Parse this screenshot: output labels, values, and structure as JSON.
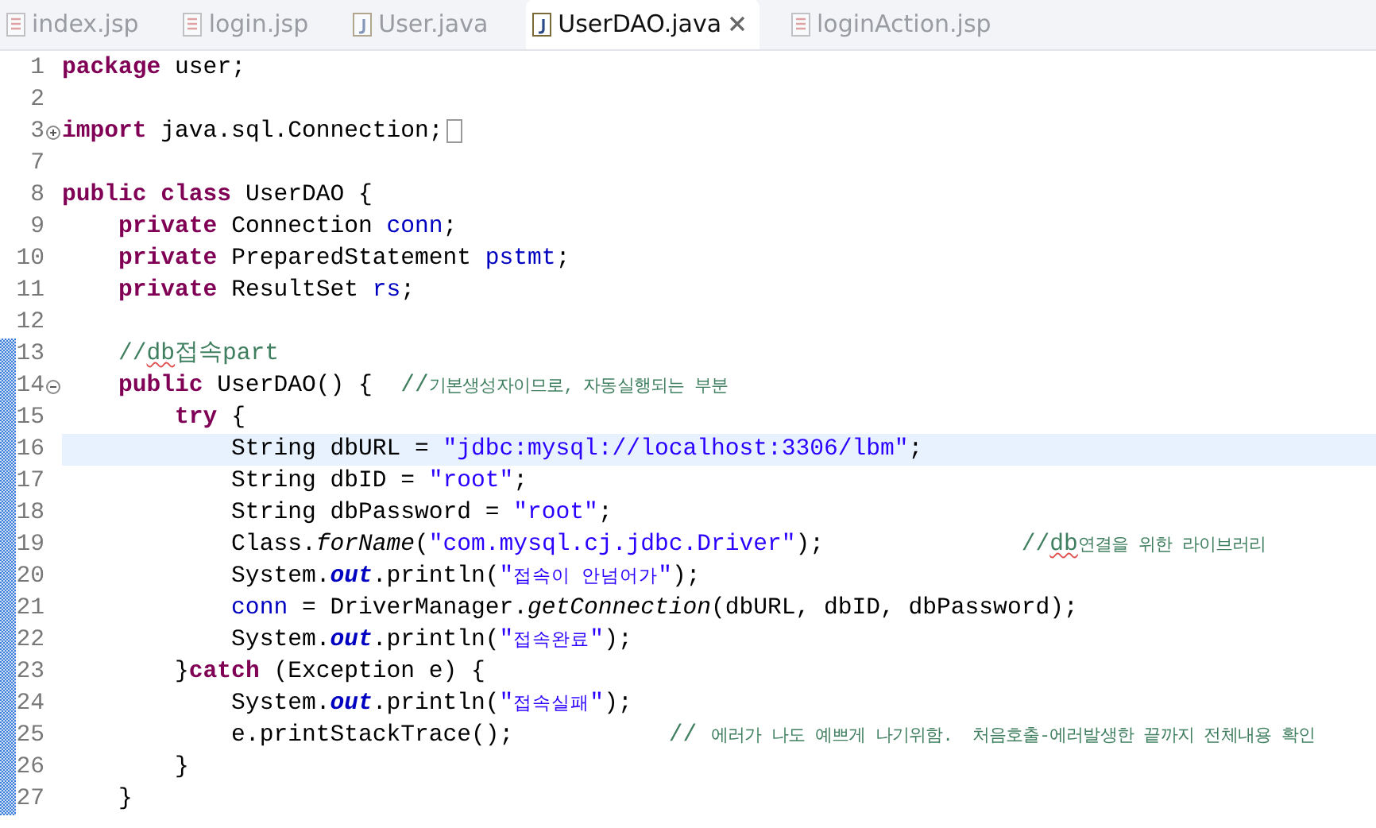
{
  "tabs": [
    {
      "label": "index.jsp",
      "kind": "jsp",
      "selected": false
    },
    {
      "label": "login.jsp",
      "kind": "jsp",
      "selected": false
    },
    {
      "label": "User.java",
      "kind": "java",
      "selected": false
    },
    {
      "label": "UserDAO.java",
      "kind": "java",
      "selected": true
    },
    {
      "label": "loginAction.jsp",
      "kind": "jsp",
      "selected": false
    }
  ],
  "code_lines": [
    {
      "number": "1",
      "changed": false,
      "current": false,
      "tokens": [
        {
          "kind": "keyword",
          "text": "package"
        },
        {
          "kind": "plain",
          "text": " user;"
        }
      ]
    },
    {
      "number": "2",
      "changed": false,
      "current": false
    },
    {
      "number": "3",
      "fold_collapsed": true,
      "changed": false,
      "current": false,
      "tokens": [
        {
          "kind": "keyword",
          "text": "import"
        },
        {
          "kind": "plain",
          "text": " java.sql.Connection;"
        }
      ]
    },
    {
      "number": "7",
      "changed": false,
      "current": false
    },
    {
      "number": "8",
      "changed": false,
      "current": false,
      "tokens": [
        {
          "kind": "keyword",
          "text": "public class"
        },
        {
          "kind": "plain",
          "text": " UserDAO {"
        }
      ]
    },
    {
      "number": "9",
      "changed": false,
      "current": false,
      "tokens": [
        {
          "kind": "keyword",
          "text": "    private"
        },
        {
          "kind": "plain",
          "text": " Connection "
        },
        {
          "kind": "field",
          "text": "conn"
        },
        {
          "kind": "plain",
          "text": ";"
        }
      ]
    },
    {
      "number": "10",
      "changed": false,
      "current": false,
      "tokens": [
        {
          "kind": "keyword",
          "text": "    private"
        },
        {
          "kind": "plain",
          "text": " PreparedStatement "
        },
        {
          "kind": "field",
          "text": "pstmt"
        },
        {
          "kind": "plain",
          "text": ";"
        }
      ]
    },
    {
      "number": "11",
      "changed": false,
      "current": false,
      "tokens": [
        {
          "kind": "keyword",
          "text": "    private"
        },
        {
          "kind": "plain",
          "text": " ResultSet "
        },
        {
          "kind": "field",
          "text": "rs"
        },
        {
          "kind": "plain",
          "text": ";"
        }
      ]
    },
    {
      "number": "12",
      "changed": false,
      "current": false
    },
    {
      "number": "13",
      "changed": true,
      "current": false,
      "tokens": [
        {
          "kind": "comment",
          "text": "    //"
        },
        {
          "kind": "comment-flagged",
          "text": "db"
        },
        {
          "kind": "comment",
          "text": "접속part"
        }
      ]
    },
    {
      "number": "14",
      "fold_collapsed": false,
      "changed": true,
      "current": false,
      "tokens": [
        {
          "kind": "keyword",
          "text": "    public"
        },
        {
          "kind": "plain",
          "text": " UserDAO() {  "
        },
        {
          "kind": "comment",
          "text": "//"
        },
        {
          "kind": "comment-small",
          "text": "기본생성자이므로, 자동실행되는 부분"
        }
      ]
    },
    {
      "number": "15",
      "changed": true,
      "current": false,
      "tokens": [
        {
          "kind": "keyword",
          "text": "        try"
        },
        {
          "kind": "plain",
          "text": " {"
        }
      ]
    },
    {
      "number": "16",
      "changed": true,
      "current": true,
      "tokens": [
        {
          "kind": "plain",
          "text": "            String dbURL = "
        },
        {
          "kind": "string",
          "text": "\"jdbc:mysql://localhost:3306/lbm\""
        },
        {
          "kind": "plain",
          "text": ";"
        }
      ]
    },
    {
      "number": "17",
      "changed": true,
      "current": false,
      "tokens": [
        {
          "kind": "plain",
          "text": "            String dbID = "
        },
        {
          "kind": "string",
          "text": "\"root\""
        },
        {
          "kind": "plain",
          "text": ";"
        }
      ]
    },
    {
      "number": "18",
      "changed": true,
      "current": false,
      "tokens": [
        {
          "kind": "plain",
          "text": "            String dbPassword = "
        },
        {
          "kind": "string",
          "text": "\"root\""
        },
        {
          "kind": "plain",
          "text": ";"
        }
      ]
    },
    {
      "number": "19",
      "changed": true,
      "current": false,
      "tokens": [
        {
          "kind": "plain",
          "text": "            Class."
        },
        {
          "kind": "method-static",
          "text": "forName"
        },
        {
          "kind": "plain",
          "text": "("
        },
        {
          "kind": "string",
          "text": "\"com.mysql.cj.jdbc.Driver\""
        },
        {
          "kind": "plain",
          "text": ");              "
        },
        {
          "kind": "comment",
          "text": "//"
        },
        {
          "kind": "comment-flagged",
          "text": "db"
        },
        {
          "kind": "comment-small",
          "text": "연결을 위한 라이브러리"
        }
      ]
    },
    {
      "number": "20",
      "changed": true,
      "current": false,
      "tokens": [
        {
          "kind": "plain",
          "text": "            System."
        },
        {
          "kind": "static-field",
          "text": "out"
        },
        {
          "kind": "plain",
          "text": ".println("
        },
        {
          "kind": "string",
          "text": "\""
        },
        {
          "kind": "string-small",
          "text": "접속이 안넘어가"
        },
        {
          "kind": "string",
          "text": "\""
        },
        {
          "kind": "plain",
          "text": ");"
        }
      ]
    },
    {
      "number": "21",
      "changed": true,
      "current": false,
      "tokens": [
        {
          "kind": "field",
          "text": "            conn"
        },
        {
          "kind": "plain",
          "text": " = DriverManager."
        },
        {
          "kind": "method-static",
          "text": "getConnection"
        },
        {
          "kind": "plain",
          "text": "(dbURL, dbID, dbPassword);"
        }
      ]
    },
    {
      "number": "22",
      "changed": true,
      "current": false,
      "tokens": [
        {
          "kind": "plain",
          "text": "            System."
        },
        {
          "kind": "static-field",
          "text": "out"
        },
        {
          "kind": "plain",
          "text": ".println("
        },
        {
          "kind": "string",
          "text": "\""
        },
        {
          "kind": "string-small",
          "text": "접속완료"
        },
        {
          "kind": "string",
          "text": "\""
        },
        {
          "kind": "plain",
          "text": ");"
        }
      ]
    },
    {
      "number": "23",
      "changed": true,
      "current": false,
      "tokens": [
        {
          "kind": "plain",
          "text": "        }"
        },
        {
          "kind": "keyword",
          "text": "catch"
        },
        {
          "kind": "plain",
          "text": " (Exception e) {"
        }
      ]
    },
    {
      "number": "24",
      "changed": true,
      "current": false,
      "tokens": [
        {
          "kind": "plain",
          "text": "            System."
        },
        {
          "kind": "static-field",
          "text": "out"
        },
        {
          "kind": "plain",
          "text": ".println("
        },
        {
          "kind": "string",
          "text": "\""
        },
        {
          "kind": "string-small",
          "text": "접속실패"
        },
        {
          "kind": "string",
          "text": "\""
        },
        {
          "kind": "plain",
          "text": ");"
        }
      ]
    },
    {
      "number": "25",
      "changed": true,
      "current": false,
      "tokens": [
        {
          "kind": "plain",
          "text": "            e.printStackTrace();           "
        },
        {
          "kind": "comment",
          "text": "// "
        },
        {
          "kind": "comment-small",
          "text": "에러가 나도 예쁘게 나기위함.  처음호출-에러발생한 끝까지 전체내용 확인"
        }
      ]
    },
    {
      "number": "26",
      "changed": true,
      "current": false,
      "tokens": [
        {
          "kind": "plain",
          "text": "        }"
        }
      ]
    },
    {
      "number": "27",
      "changed": true,
      "current": false,
      "tokens": [
        {
          "kind": "plain",
          "text": "    }"
        }
      ]
    }
  ]
}
